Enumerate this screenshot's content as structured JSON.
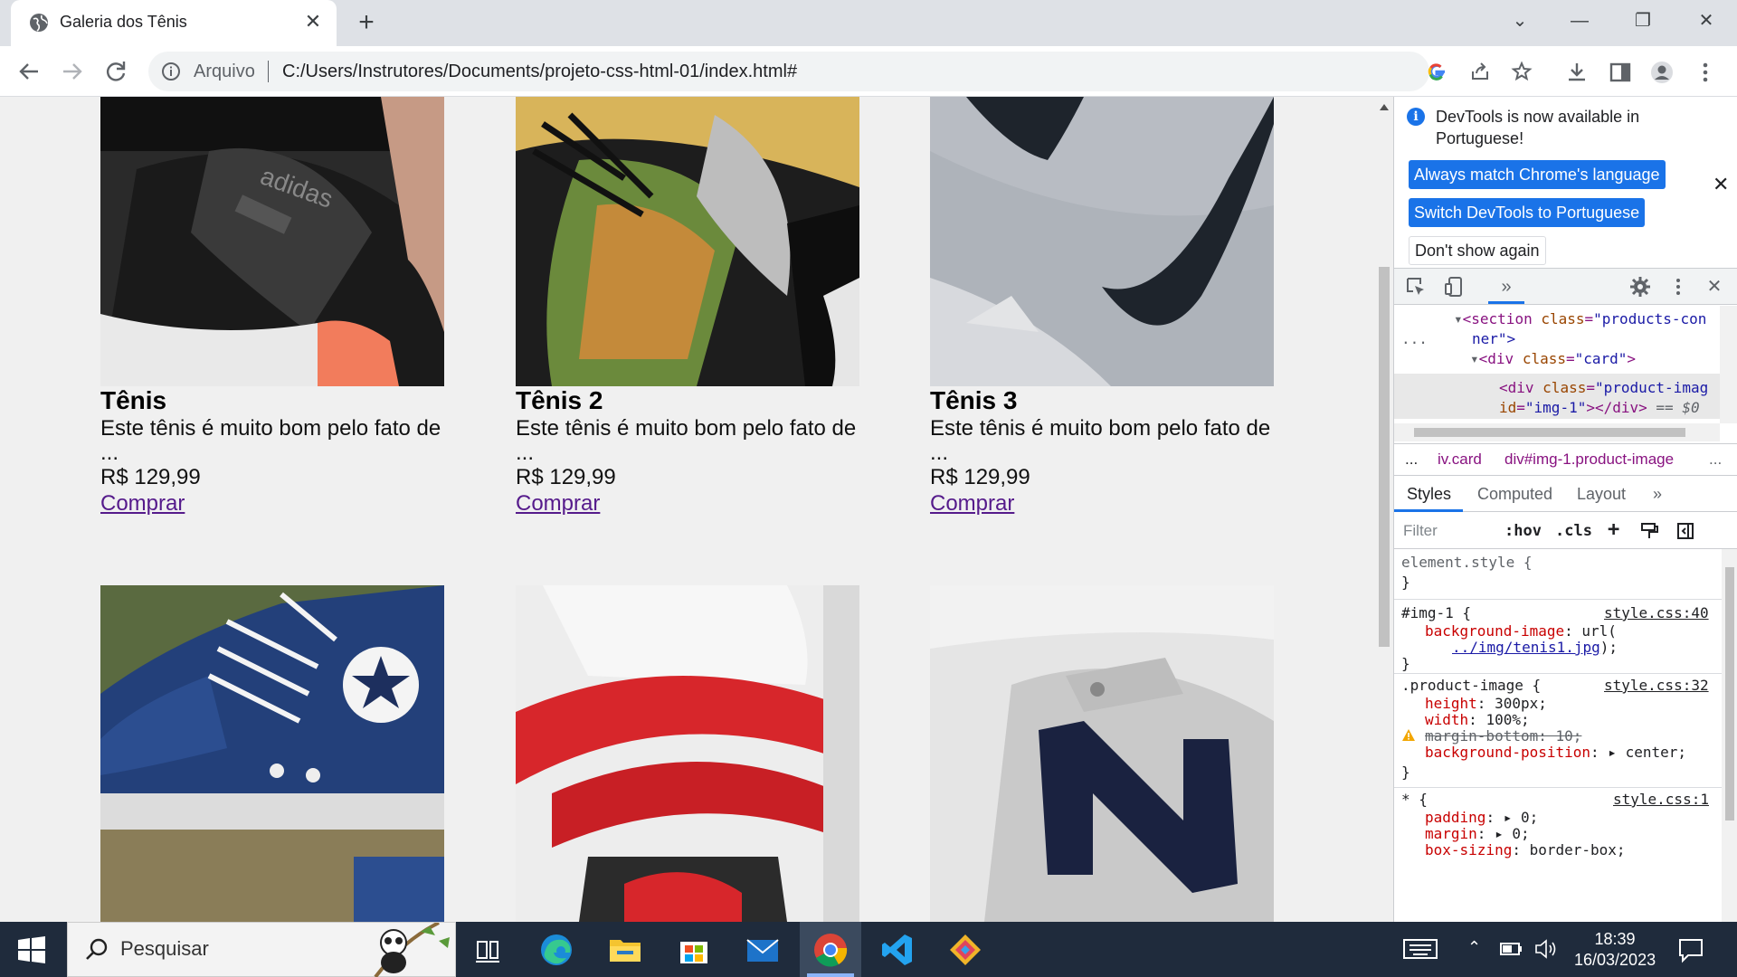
{
  "browser": {
    "tab_title": "Galeria dos Tênis",
    "scheme_label": "Arquivo",
    "url": "C:/Users/Instrutores/Documents/projeto-css-html-01/index.html#"
  },
  "products": [
    {
      "name": "Tênis",
      "description": "Este tênis é muito bom pelo fato de",
      "ellipsis": "...",
      "price": "R$ 129,99",
      "buy": "Comprar"
    },
    {
      "name": "Tênis 2",
      "description": "Este tênis é muito bom pelo fato de",
      "ellipsis": "...",
      "price": "R$ 129,99",
      "buy": "Comprar"
    },
    {
      "name": "Tênis 3",
      "description": "Este tênis é muito bom pelo fato de",
      "ellipsis": "...",
      "price": "R$ 129,99",
      "buy": "Comprar"
    }
  ],
  "devtools": {
    "banner": {
      "message": "DevTools is now available in Portuguese!",
      "btn_match": "Always match Chrome's language",
      "btn_switch": "Switch DevTools to Portuguese",
      "btn_dont_show": "Don't show again"
    },
    "elements": {
      "line1_tag": "<section ",
      "line1_attr": "class",
      "line1_val": "\"products-con",
      "line1_tail": "ner\">",
      "line2_tag": "<div ",
      "line2_attr": "class",
      "line2_val": "\"card\"",
      "line2_end": ">",
      "line3_tag": "<div ",
      "line3_attr": "class",
      "line3_val": "\"product-imag",
      "line4_attr": "id",
      "line4_val": "\"img-1\"",
      "line4_end": "></div>",
      "line4_eq": " == $0",
      "ellipsis": "..."
    },
    "breadcrumbs": [
      "...",
      "iv.card",
      "div#img-1.product-image",
      "..."
    ],
    "tabs": [
      "Styles",
      "Computed",
      "Layout",
      "»"
    ],
    "filter_placeholder": "Filter",
    "hov": ":hov",
    "cls": ".cls",
    "styles": {
      "element_style": "element.style {",
      "close": "}",
      "rule1_selector": "#img-1 {",
      "rule1_source": "style.css:40",
      "rule1_prop": "background-image",
      "rule1_val_pre": ": url(",
      "rule1_url": "../img/tenis1.jpg",
      "rule1_val_post": ");",
      "rule2_selector": ".product-image {",
      "rule2_source": "style.css:32",
      "rule2_height_prop": "height",
      "rule2_height_val": ": 300px;",
      "rule2_width_prop": "width",
      "rule2_width_val": ": 100%;",
      "rule2_margin_text": "margin-bottom: 10;",
      "rule2_bgpos_prop": "background-position",
      "rule2_bgpos_val": ": ▸ center;",
      "rule3_selector": "* {",
      "rule3_source": "style.css:1",
      "rule3_padding_prop": "padding",
      "rule3_padding_val": ": ▸ 0;",
      "rule3_margin_prop": "margin",
      "rule3_margin_val": ": ▸ 0;",
      "rule3_boxsizing_prop": "box-sizing",
      "rule3_boxsizing_val": ": border-box;"
    }
  },
  "taskbar": {
    "search_placeholder": "Pesquisar",
    "time": "18:39",
    "date": "16/03/2023"
  }
}
